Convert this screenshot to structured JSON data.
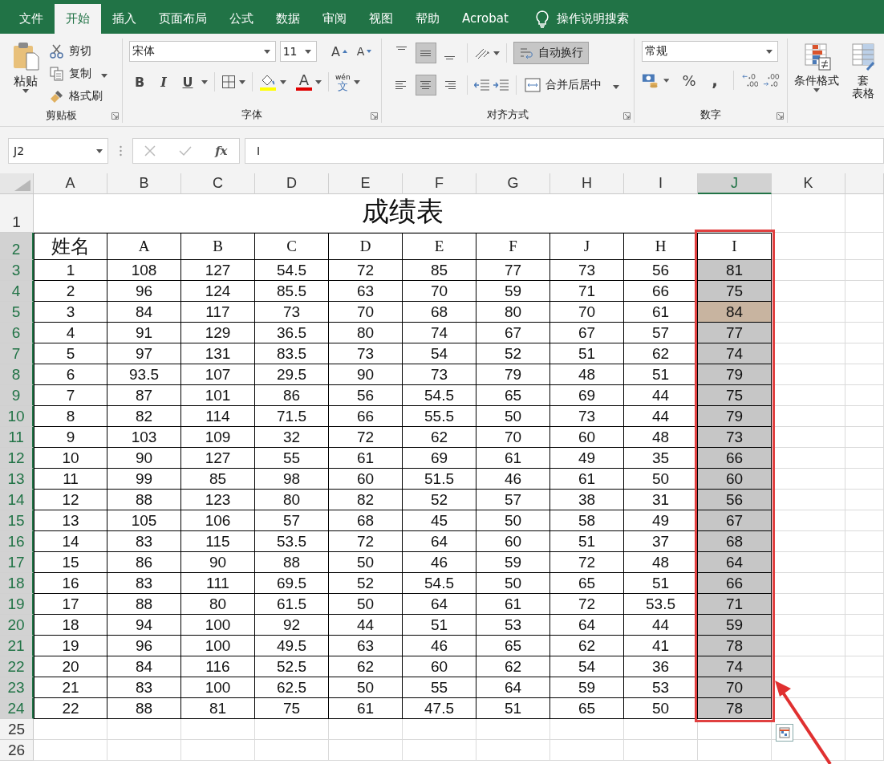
{
  "ribbon_tabs": [
    {
      "label": "文件",
      "selected": false
    },
    {
      "label": "开始",
      "selected": true
    },
    {
      "label": "插入",
      "selected": false
    },
    {
      "label": "页面布局",
      "selected": false
    },
    {
      "label": "公式",
      "selected": false
    },
    {
      "label": "数据",
      "selected": false
    },
    {
      "label": "审阅",
      "selected": false
    },
    {
      "label": "视图",
      "selected": false
    },
    {
      "label": "帮助",
      "selected": false
    },
    {
      "label": "Acrobat",
      "selected": false
    }
  ],
  "tell_me": "操作说明搜索",
  "clipboard": {
    "paste": "粘贴",
    "cut": "剪切",
    "copy": "复制",
    "format_painter": "格式刷",
    "group": "剪贴板"
  },
  "font": {
    "name": "宋体",
    "size": "11",
    "grow": "A",
    "shrink": "A",
    "bold": "B",
    "italic": "I",
    "underline": "U",
    "font_color": "A",
    "phonetic_top": "wén",
    "phonetic_char": "文",
    "group": "字体"
  },
  "alignment": {
    "buttons": [
      {
        "kind": "top",
        "selected": false
      },
      {
        "kind": "middle",
        "selected": true
      },
      {
        "kind": "bottom",
        "selected": false
      },
      {
        "kind": "left",
        "selected": false
      },
      {
        "kind": "center",
        "selected": true
      },
      {
        "kind": "right",
        "selected": false
      }
    ],
    "wrap_text": "自动换行",
    "wrap_selected": true,
    "merge": "合并后居中",
    "group": "对齐方式"
  },
  "number": {
    "format": "常规",
    "percent": "%",
    "comma": ",",
    "group": "数字"
  },
  "styles": {
    "conditional": "条件格式",
    "table_line1": "套",
    "table_line2": "表格"
  },
  "formula_bar": {
    "name_box": "J2",
    "fx": "fx",
    "formula": "I"
  },
  "sheet": {
    "columns": [
      {
        "label": "A",
        "selected": false
      },
      {
        "label": "B",
        "selected": false
      },
      {
        "label": "C",
        "selected": false
      },
      {
        "label": "D",
        "selected": false
      },
      {
        "label": "E",
        "selected": false
      },
      {
        "label": "F",
        "selected": false
      },
      {
        "label": "G",
        "selected": false
      },
      {
        "label": "H",
        "selected": false
      },
      {
        "label": "I",
        "selected": false
      },
      {
        "label": "J",
        "selected": true
      },
      {
        "label": "K",
        "selected": false
      }
    ],
    "row_numbers": [
      {
        "label": "1",
        "selected": false
      },
      {
        "label": "2",
        "selected": true
      },
      {
        "label": "3",
        "selected": true
      },
      {
        "label": "4",
        "selected": true
      },
      {
        "label": "5",
        "selected": true
      },
      {
        "label": "6",
        "selected": true
      },
      {
        "label": "7",
        "selected": true
      },
      {
        "label": "8",
        "selected": true
      },
      {
        "label": "9",
        "selected": true
      },
      {
        "label": "10",
        "selected": true
      },
      {
        "label": "11",
        "selected": true
      },
      {
        "label": "12",
        "selected": true
      },
      {
        "label": "13",
        "selected": true
      },
      {
        "label": "14",
        "selected": true
      },
      {
        "label": "15",
        "selected": true
      },
      {
        "label": "16",
        "selected": true
      },
      {
        "label": "17",
        "selected": true
      },
      {
        "label": "18",
        "selected": true
      },
      {
        "label": "19",
        "selected": true
      },
      {
        "label": "20",
        "selected": true
      },
      {
        "label": "21",
        "selected": true
      },
      {
        "label": "22",
        "selected": true
      },
      {
        "label": "23",
        "selected": true
      },
      {
        "label": "24",
        "selected": true
      },
      {
        "label": "25",
        "selected": false
      },
      {
        "label": "26",
        "selected": false
      }
    ],
    "title": "成绩表",
    "header": [
      "姓名",
      "A",
      "B",
      "C",
      "D",
      "E",
      "F",
      "J",
      "H",
      "I"
    ],
    "rows": [
      {
        "cells": [
          "1",
          "108",
          "127",
          "54.5",
          "72",
          "85",
          "77",
          "73",
          "56",
          "81"
        ],
        "marked": false
      },
      {
        "cells": [
          "2",
          "96",
          "124",
          "85.5",
          "63",
          "70",
          "59",
          "71",
          "66",
          "75"
        ],
        "marked": false
      },
      {
        "cells": [
          "3",
          "84",
          "117",
          "73",
          "70",
          "68",
          "80",
          "70",
          "61",
          "84"
        ],
        "marked": true
      },
      {
        "cells": [
          "4",
          "91",
          "129",
          "36.5",
          "80",
          "74",
          "67",
          "67",
          "57",
          "77"
        ],
        "marked": false
      },
      {
        "cells": [
          "5",
          "97",
          "131",
          "83.5",
          "73",
          "54",
          "52",
          "51",
          "62",
          "74"
        ],
        "marked": false
      },
      {
        "cells": [
          "6",
          "93.5",
          "107",
          "29.5",
          "90",
          "73",
          "79",
          "48",
          "51",
          "79"
        ],
        "marked": false
      },
      {
        "cells": [
          "7",
          "87",
          "101",
          "86",
          "56",
          "54.5",
          "65",
          "69",
          "44",
          "75"
        ],
        "marked": false
      },
      {
        "cells": [
          "8",
          "82",
          "114",
          "71.5",
          "66",
          "55.5",
          "50",
          "73",
          "44",
          "79"
        ],
        "marked": false
      },
      {
        "cells": [
          "9",
          "103",
          "109",
          "32",
          "72",
          "62",
          "70",
          "60",
          "48",
          "73"
        ],
        "marked": false
      },
      {
        "cells": [
          "10",
          "90",
          "127",
          "55",
          "61",
          "69",
          "61",
          "49",
          "35",
          "66"
        ],
        "marked": false
      },
      {
        "cells": [
          "11",
          "99",
          "85",
          "98",
          "60",
          "51.5",
          "46",
          "61",
          "50",
          "60"
        ],
        "marked": false
      },
      {
        "cells": [
          "12",
          "88",
          "123",
          "80",
          "82",
          "52",
          "57",
          "38",
          "31",
          "56"
        ],
        "marked": false
      },
      {
        "cells": [
          "13",
          "105",
          "106",
          "57",
          "68",
          "45",
          "50",
          "58",
          "49",
          "67"
        ],
        "marked": false
      },
      {
        "cells": [
          "14",
          "83",
          "115",
          "53.5",
          "72",
          "64",
          "60",
          "51",
          "37",
          "68"
        ],
        "marked": false
      },
      {
        "cells": [
          "15",
          "86",
          "90",
          "88",
          "50",
          "46",
          "59",
          "72",
          "48",
          "64"
        ],
        "marked": false
      },
      {
        "cells": [
          "16",
          "83",
          "111",
          "69.5",
          "52",
          "54.5",
          "50",
          "65",
          "51",
          "66"
        ],
        "marked": false
      },
      {
        "cells": [
          "17",
          "88",
          "80",
          "61.5",
          "50",
          "64",
          "61",
          "72",
          "53.5",
          "71"
        ],
        "marked": false
      },
      {
        "cells": [
          "18",
          "94",
          "100",
          "92",
          "44",
          "51",
          "53",
          "64",
          "44",
          "59"
        ],
        "marked": false
      },
      {
        "cells": [
          "19",
          "96",
          "100",
          "49.5",
          "63",
          "46",
          "65",
          "62",
          "41",
          "78"
        ],
        "marked": false
      },
      {
        "cells": [
          "20",
          "84",
          "116",
          "52.5",
          "62",
          "60",
          "62",
          "54",
          "36",
          "74"
        ],
        "marked": false
      },
      {
        "cells": [
          "21",
          "83",
          "100",
          "62.5",
          "50",
          "55",
          "64",
          "59",
          "53",
          "70"
        ],
        "marked": false
      },
      {
        "cells": [
          "22",
          "88",
          "81",
          "75",
          "61",
          "47.5",
          "51",
          "65",
          "50",
          "78"
        ],
        "marked": false
      }
    ]
  }
}
